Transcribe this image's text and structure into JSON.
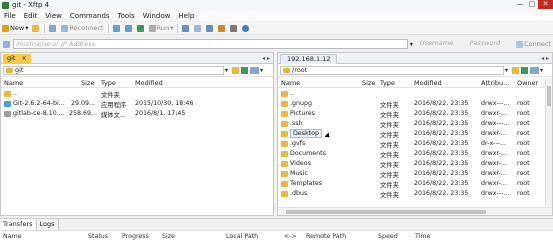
{
  "window": {
    "title": "git - Xftp 4",
    "buttons": [
      "—",
      "□",
      "✕"
    ]
  },
  "menu": [
    "File",
    "Edit",
    "View",
    "Commands",
    "Tools",
    "Window",
    "Help"
  ],
  "toolbar": {
    "new_label": "New",
    "reconnect_label": "Reconnect",
    "run_label": "Run"
  },
  "address": {
    "host_placeholder": "Hostname or IP Address",
    "user_placeholder": "Username",
    "pass_placeholder": "Password",
    "connect_label": "Connect"
  },
  "left_pane": {
    "tab_label": "git",
    "path": "git",
    "headers": [
      "Name",
      "Size",
      "Type",
      "Modified"
    ],
    "rows": [
      {
        "name": "..",
        "size": "",
        "type": "文件夹",
        "modified": "",
        "icon": "up-folder-icon"
      },
      {
        "name": "Git-2.6.2-64-bi...",
        "size": "29.09...",
        "type": "应用程序",
        "modified": "2015/10/30, 18:46",
        "icon": "exe-icon"
      },
      {
        "name": "gitlab-ce-8.10....",
        "size": "258.69...",
        "type": "媒体文...",
        "modified": "2016/8/1, 17:45",
        "icon": "iso-icon"
      }
    ]
  },
  "right_pane": {
    "tab_label": "192.168.1.12",
    "path": "/root",
    "headers": [
      "Name",
      "Size",
      "Type",
      "Modified",
      "Attribu...",
      "Owner"
    ],
    "rows": [
      {
        "name": "..",
        "type": "",
        "modified": "",
        "attr": "",
        "owner": ""
      },
      {
        "name": ".gnupg",
        "type": "文件夹",
        "modified": "2016/8/22, 23:35",
        "attr": "drwx---...",
        "owner": "root"
      },
      {
        "name": "Pictures",
        "type": "文件夹",
        "modified": "2016/8/22, 23:35",
        "attr": "drwxr-...",
        "owner": "root"
      },
      {
        "name": ".ssh",
        "type": "文件夹",
        "modified": "2016/8/22, 23:35",
        "attr": "drwx---...",
        "owner": "root"
      },
      {
        "name": "Desktop",
        "type": "文件夹",
        "modified": "2016/8/22, 23:35",
        "attr": "drwxr-...",
        "owner": "root"
      },
      {
        "name": ".gvfs",
        "type": "文件夹",
        "modified": "2016/8/22, 23:35",
        "attr": "dr-x---...",
        "owner": "root"
      },
      {
        "name": "Documents",
        "type": "文件夹",
        "modified": "2016/8/22, 23:35",
        "attr": "drwxr-...",
        "owner": "root"
      },
      {
        "name": "Videos",
        "type": "文件夹",
        "modified": "2016/8/22, 23:35",
        "attr": "drwxr-...",
        "owner": "root"
      },
      {
        "name": "Music",
        "type": "文件夹",
        "modified": "2016/8/22, 23:35",
        "attr": "drwxr-...",
        "owner": "root"
      },
      {
        "name": "Templates",
        "type": "文件夹",
        "modified": "2016/8/22, 23:35",
        "attr": "drwxr-...",
        "owner": "root"
      },
      {
        "name": ".dbus",
        "type": "文件夹",
        "modified": "2016/8/22, 23:35",
        "attr": "drwx---...",
        "owner": "root"
      }
    ]
  },
  "bottom_tabs": [
    "Transfers",
    "Logs"
  ],
  "transfer_headers": [
    "Name",
    "Status",
    "Progress",
    "Size",
    "Local Path",
    "<->",
    "Remote Path",
    "Speed",
    "Time"
  ],
  "colors": {
    "left_tab_bg": "#f7c948",
    "right_tab_bg": "#e8eef7",
    "close_red": "#c42b1c"
  }
}
